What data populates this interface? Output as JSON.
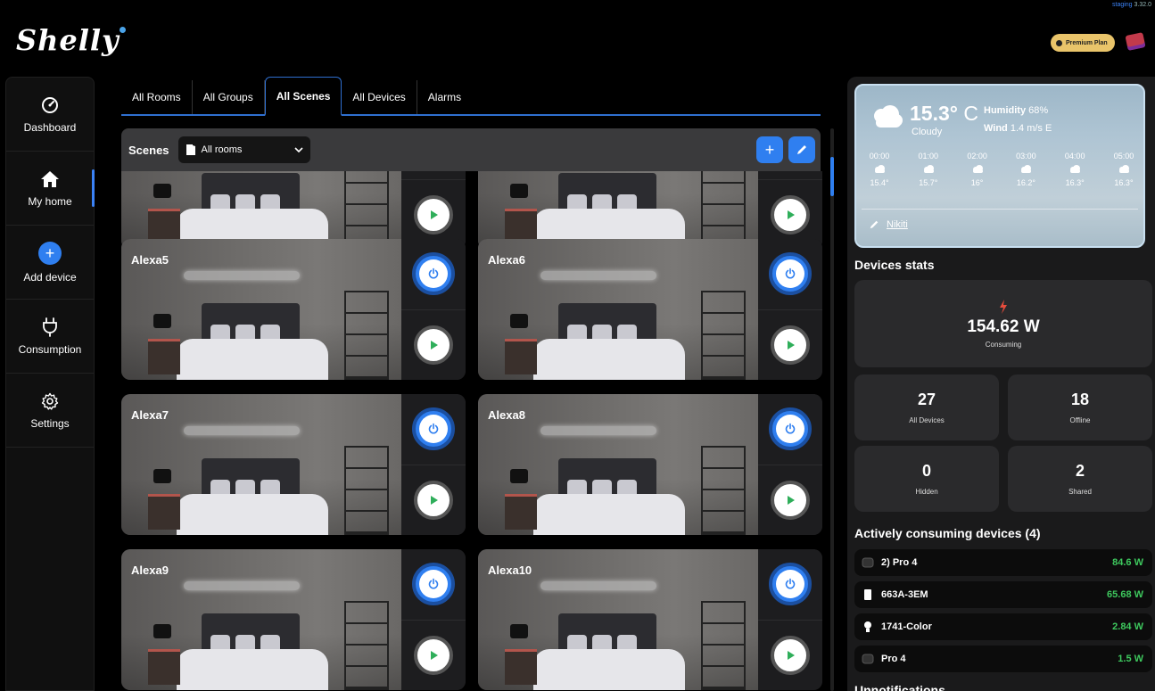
{
  "app": {
    "logo": "Shelly",
    "version_prefix": "staging",
    "version": "3.32.0",
    "premium_label": "Premium Plan"
  },
  "sidebar": {
    "items": [
      {
        "label": "Dashboard",
        "icon": "gauge-icon"
      },
      {
        "label": "My home",
        "icon": "home-icon",
        "active": true
      },
      {
        "label": "Add device",
        "icon": "plus-icon"
      },
      {
        "label": "Consumption",
        "icon": "plug-icon"
      },
      {
        "label": "Settings",
        "icon": "gear-icon"
      }
    ]
  },
  "tabs": {
    "items": [
      "All Rooms",
      "All Groups",
      "All Scenes",
      "All Devices",
      "Alarms"
    ],
    "active": "All Scenes"
  },
  "scenes_bar": {
    "title": "Scenes",
    "room_filter": "All rooms"
  },
  "scenes": [
    {
      "name": ""
    },
    {
      "name": ""
    },
    {
      "name": "Alexa5"
    },
    {
      "name": "Alexa6"
    },
    {
      "name": "Alexa7"
    },
    {
      "name": "Alexa8"
    },
    {
      "name": "Alexa9"
    },
    {
      "name": "Alexa10"
    }
  ],
  "weather": {
    "temperature": "15.3°",
    "unit": "C",
    "condition": "Cloudy",
    "humidity_label": "Humidity",
    "humidity_value": "68%",
    "wind_label": "Wind",
    "wind_value": "1.4 m/s E",
    "forecast": [
      {
        "time": "00:00",
        "temp": "15.4°"
      },
      {
        "time": "01:00",
        "temp": "15.7°"
      },
      {
        "time": "02:00",
        "temp": "16°"
      },
      {
        "time": "03:00",
        "temp": "16.2°"
      },
      {
        "time": "04:00",
        "temp": "16.3°"
      },
      {
        "time": "05:00",
        "temp": "16.3°"
      }
    ],
    "location": "Nikiti"
  },
  "device_stats": {
    "title": "Devices stats",
    "consuming_value": "154.62 W",
    "consuming_label": "Consuming",
    "all_devices_value": "27",
    "all_devices_label": "All Devices",
    "offline_value": "18",
    "offline_label": "Offline",
    "hidden_value": "0",
    "hidden_label": "Hidden",
    "shared_value": "2",
    "shared_label": "Shared"
  },
  "consuming": {
    "title": "Actively consuming devices (4)",
    "devices": [
      {
        "name": "2) Pro 4",
        "power": "84.6 W"
      },
      {
        "name": "663A-3EM",
        "power": "65.68 W"
      },
      {
        "name": "1741-Color",
        "power": "2.84 W"
      },
      {
        "name": "Pro 4",
        "power": "1.5 W"
      }
    ]
  },
  "notifications": {
    "title": "Unnotifications"
  },
  "colors": {
    "accent": "#2f7ff0",
    "power_green": "#3ec95e",
    "premium": "#e9c46a"
  }
}
